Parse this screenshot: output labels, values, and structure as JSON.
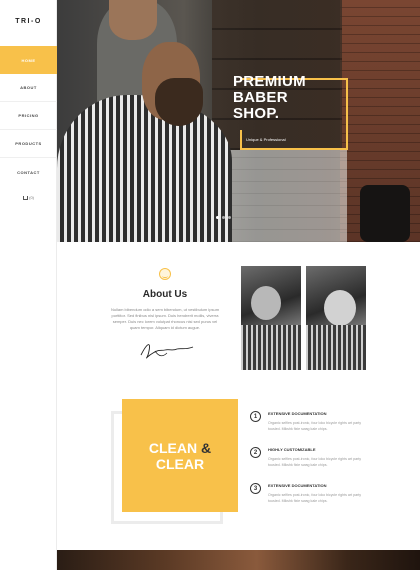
{
  "brand": {
    "logo": "TRI-O",
    "accent_color": "#f8c14a"
  },
  "nav": {
    "items": [
      {
        "label": "Home",
        "active": true
      },
      {
        "label": "About",
        "active": false
      },
      {
        "label": "Pricing",
        "active": false
      },
      {
        "label": "Products",
        "active": false
      },
      {
        "label": "Contact",
        "active": false
      }
    ],
    "cart_count": "(0)",
    "cart_icon": "cart-icon"
  },
  "hero": {
    "title_line1": "PREMIUM",
    "title_line2": "BABER",
    "title_line3": "SHOP.",
    "subtitle": "Unique & Professional",
    "slides": 3,
    "active_slide": 1
  },
  "about": {
    "icon": "barber-icon",
    "title": "About Us",
    "text": "Nullam bibendum odio a sem bibendum, ut vestibulum ipsum porttitor. Sed finibus nisl ipsum. Duis hendrerit mollis, viverra semper. Duis nec lorem volutpat rhoncus nisi sed purus vel quam tempor. Aliquam id dictum augue."
  },
  "clean": {
    "word1": "CLEAN",
    "amp": "&",
    "word2": "CLEAR"
  },
  "features": [
    {
      "num": "1",
      "title": "EXTENSIVE DOCUMENTATION",
      "text": "Organic selfies post-ironic, four loko bicycle rights art party tousled. Mlkshk fixie swag kale chips."
    },
    {
      "num": "2",
      "title": "HIGHLY CUSTOMIZABLE",
      "text": "Organic selfies post-ironic, four loko bicycle rights art party tousled. Mlkshk fixie swag kale chips."
    },
    {
      "num": "3",
      "title": "EXTENSIVE DOCUMENTATION",
      "text": "Organic selfies post-ironic, four loko bicycle rights art party tousled. Mlkshk fixie swag kale chips."
    }
  ]
}
